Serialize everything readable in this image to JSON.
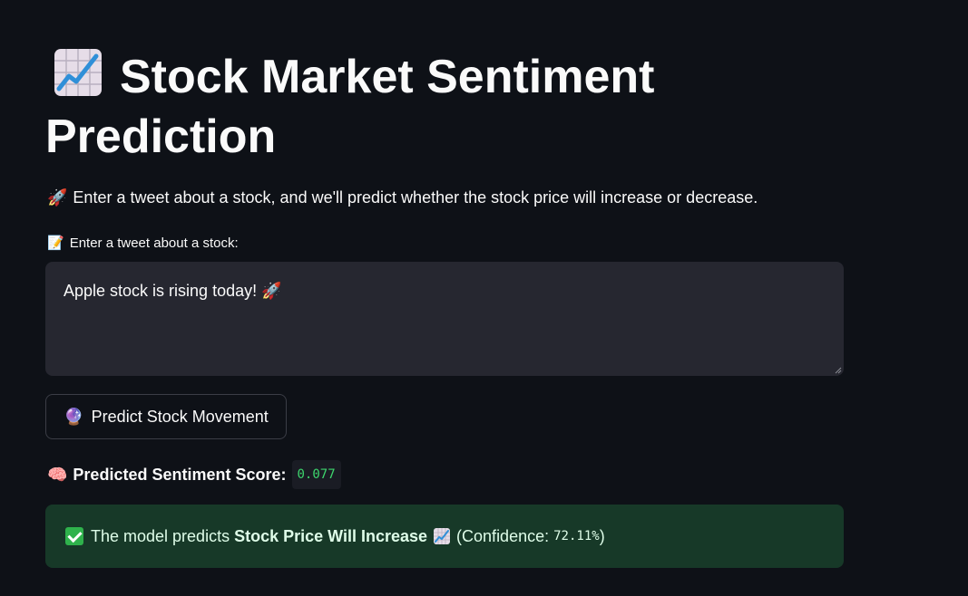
{
  "page": {
    "title": "Stock Market Sentiment Prediction",
    "title_icon": "chart-increasing-icon",
    "subtitle_icon": "rocket-icon",
    "subtitle": "Enter a tweet about a stock, and we'll predict whether the stock price will increase or decrease."
  },
  "input": {
    "label_icon": "memo-icon",
    "label": "Enter a tweet about a stock:",
    "value": "Apple stock is rising today! 🚀"
  },
  "predict_button": {
    "icon": "crystal-ball-icon",
    "label": "Predict Stock Movement"
  },
  "score": {
    "icon": "brain-icon",
    "label": "Predicted Sentiment Score:",
    "value": "0.077"
  },
  "result": {
    "icon": "check-mark-icon",
    "prefix": "The model predicts",
    "prediction": "Stock Price Will Increase",
    "trend_icon": "chart-increasing-icon",
    "confidence_label": "(Confidence:",
    "confidence_value": "72.11%",
    "confidence_suffix": ")"
  },
  "colors": {
    "background": "#0e1117",
    "input_bg": "#262730",
    "success_bg": "#173928",
    "code_green": "#3dd56d"
  }
}
